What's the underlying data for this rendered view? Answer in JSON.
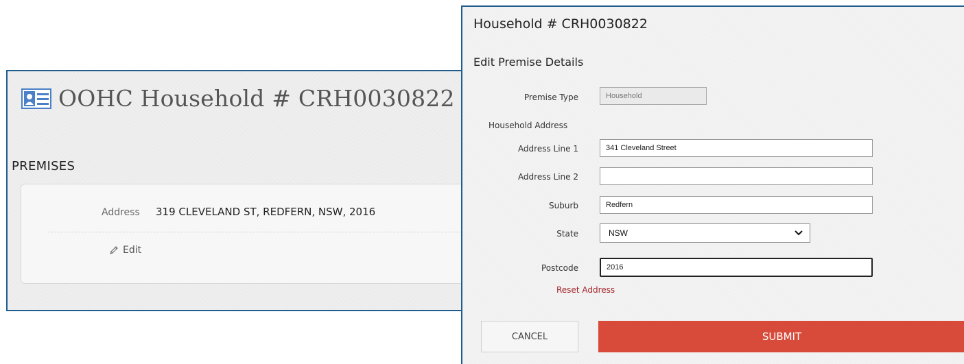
{
  "background_page": {
    "title": "OOHC Household # CRH0030822",
    "section_heading": "PREMISES",
    "address_label": "Address",
    "address_value": "319 CLEVELAND ST, REDFERN, NSW, 2016",
    "edit_label": "Edit"
  },
  "modal": {
    "title": "Household # CRH0030822",
    "subtitle": "Edit Premise Details",
    "fields": {
      "premise_type_label": "Premise Type",
      "premise_type_value": "Household",
      "household_address_label": "Household Address",
      "address_line1_label": "Address Line 1",
      "address_line1_value": "341 Cleveland Street",
      "address_line2_label": "Address Line 2",
      "address_line2_value": "",
      "suburb_label": "Suburb",
      "suburb_value": "Redfern",
      "state_label": "State",
      "state_value": "NSW",
      "postcode_label": "Postcode",
      "postcode_value": "2016"
    },
    "reset_address_label": "Reset Address",
    "cancel_label": "CANCEL",
    "submit_label": "SUBMIT"
  },
  "colors": {
    "border_blue": "#1f5d8f",
    "submit_red": "#d84a3a",
    "reset_red": "#a3262c",
    "icon_blue": "#4a80c8"
  },
  "icons": [
    "contact-card-icon",
    "pencil-icon",
    "chevron-down-icon"
  ]
}
